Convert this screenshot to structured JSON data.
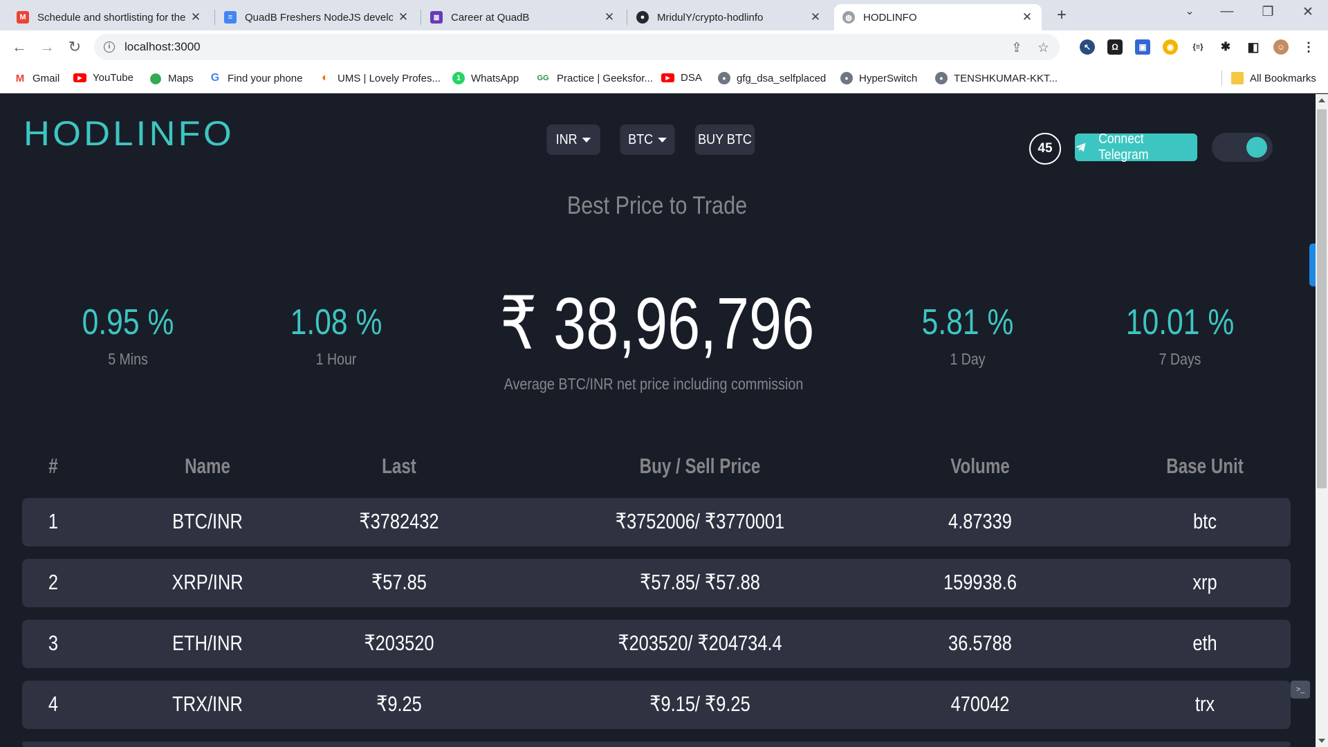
{
  "browser": {
    "tabs": [
      {
        "title": "Schedule and shortlisting for the",
        "icon": "gmail-icon",
        "color": "#ea4335",
        "glyph": "M"
      },
      {
        "title": "QuadB Freshers NodeJS develop",
        "icon": "docs-icon",
        "color": "#4285f4",
        "glyph": "≡"
      },
      {
        "title": "Career at QuadB",
        "icon": "forms-icon",
        "color": "#673ab7",
        "glyph": "≣"
      },
      {
        "title": "MridulY/crypto-hodlinfo",
        "icon": "github-icon",
        "color": "#24292e",
        "glyph": "●"
      },
      {
        "title": "HODLINFO",
        "icon": "globe-icon",
        "color": "#9aa0a6",
        "glyph": "◍"
      }
    ],
    "url": "localhost:3000",
    "bookmarks": [
      {
        "label": "Gmail",
        "icon": "gmail-icon",
        "color": "#ea4335",
        "glyph": "M"
      },
      {
        "label": "YouTube",
        "icon": "youtube-icon",
        "color": "#ff0000",
        "glyph": "▶"
      },
      {
        "label": "Maps",
        "icon": "maps-icon",
        "color": "#34a853",
        "glyph": "⬤"
      },
      {
        "label": "Find your phone",
        "icon": "google-icon",
        "color": "#4285f4",
        "glyph": "G"
      },
      {
        "label": "UMS | Lovely Profes...",
        "icon": "ums-icon",
        "color": "#e8710a",
        "glyph": "◐"
      },
      {
        "label": "WhatsApp",
        "icon": "whatsapp-icon",
        "color": "#25d366",
        "glyph": "1"
      },
      {
        "label": "Practice | Geeksfor...",
        "icon": "geeksforgeeks-icon",
        "color": "#2f8d46",
        "glyph": "GG"
      },
      {
        "label": "DSA",
        "icon": "youtube-icon",
        "color": "#ff0000",
        "glyph": "▶"
      },
      {
        "label": "gfg_dsa_selfplaced",
        "icon": "github-icon",
        "color": "#6e7681",
        "glyph": "●"
      },
      {
        "label": "HyperSwitch",
        "icon": "github-icon",
        "color": "#6e7681",
        "glyph": "●"
      },
      {
        "label": "TENSHKUMAR-KKT...",
        "icon": "github-icon",
        "color": "#6e7681",
        "glyph": "●"
      }
    ],
    "all_bookmarks": "All Bookmarks"
  },
  "header": {
    "logo": "HODLINFO",
    "currency": "INR",
    "coin": "BTC",
    "buy_label": "BUY BTC",
    "timer": "45",
    "telegram_label": "Connect Telegram"
  },
  "main": {
    "subtitle": "Best Price to Trade",
    "stats": [
      {
        "value": "0.95 %",
        "label": "5 Mins"
      },
      {
        "value": "1.08 %",
        "label": "1 Hour"
      },
      {
        "value": "5.81 %",
        "label": "1 Day"
      },
      {
        "value": "10.01 %",
        "label": "7 Days"
      }
    ],
    "price": "₹ 38,96,796",
    "price_caption": "Average BTC/INR net price including commission"
  },
  "table": {
    "headers": [
      "#",
      "Name",
      "Last",
      "Buy / Sell Price",
      "Volume",
      "Base Unit"
    ],
    "rows": [
      [
        "1",
        "BTC/INR",
        "₹3782432",
        "₹3752006/ ₹3770001",
        "4.87339",
        "btc"
      ],
      [
        "2",
        "XRP/INR",
        "₹57.85",
        "₹57.85/ ₹57.88",
        "159938.6",
        "xrp"
      ],
      [
        "3",
        "ETH/INR",
        "₹203520",
        "₹203520/ ₹204734.4",
        "36.5788",
        "eth"
      ],
      [
        "4",
        "TRX/INR",
        "₹9.25",
        "₹9.15/ ₹9.25",
        "470042",
        "trx"
      ]
    ]
  },
  "colors": {
    "accent": "#3dc6c1",
    "background": "#191d28",
    "panel": "#2e3241",
    "muted": "#86868a"
  }
}
